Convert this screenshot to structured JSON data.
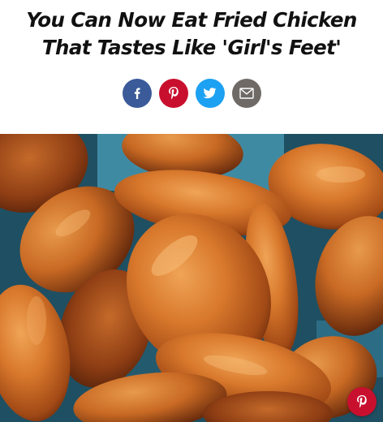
{
  "article": {
    "title_line1": "You Can Now Eat Fried Chicken",
    "title_line2": "That Tastes Like 'Girl's Feet'"
  },
  "share": {
    "buttons": [
      {
        "network": "facebook",
        "icon": "facebook-icon",
        "color": "#3b5a9a"
      },
      {
        "network": "pinterest",
        "icon": "pinterest-icon",
        "color": "#c8102e"
      },
      {
        "network": "twitter",
        "icon": "twitter-icon",
        "color": "#1da1f2"
      },
      {
        "network": "email",
        "icon": "mail-icon",
        "color": "#6f6a66"
      }
    ]
  },
  "hero_image": {
    "subject": "fried chicken wings",
    "pin_button": {
      "icon": "pinterest-icon",
      "color": "#c8102e"
    }
  },
  "colors": {
    "headline": "#111111",
    "background": "#ffffff"
  }
}
